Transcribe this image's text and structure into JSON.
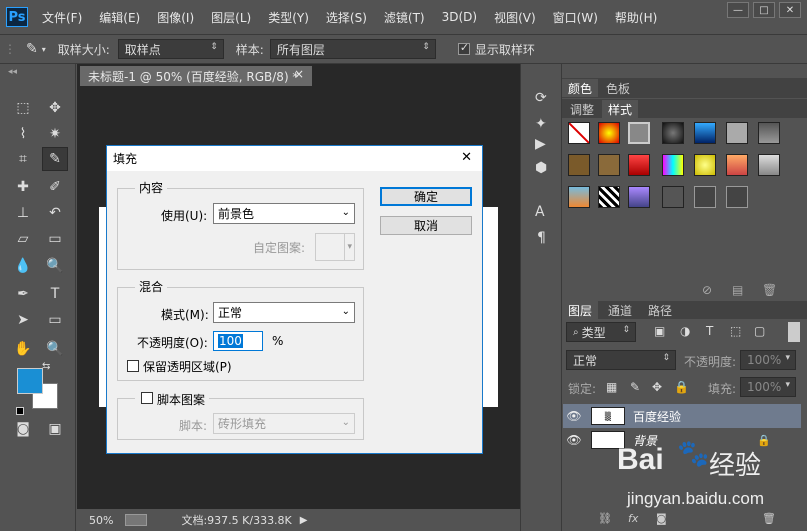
{
  "app": {
    "logo": "Ps"
  },
  "menu": [
    "文件(F)",
    "编辑(E)",
    "图像(I)",
    "图层(L)",
    "类型(Y)",
    "选择(S)",
    "滤镜(T)",
    "3D(D)",
    "视图(V)",
    "窗口(W)",
    "帮助(H)"
  ],
  "window_buttons": {
    "minimize": "—",
    "restore": "□",
    "close": "✕"
  },
  "options": {
    "sample_size_label": "取样大小:",
    "sample_size_value": "取样点",
    "sample_label": "样本:",
    "sample_value": "所有图层",
    "show_ring_label": "显示取样环",
    "show_ring_checked": true
  },
  "document": {
    "tab_title": "未标题-1 @ 50% (百度经验, RGB/8) *",
    "tab_close": "×"
  },
  "status": {
    "zoom": "50%",
    "doc_info": "文档:937.5 K/333.8K"
  },
  "colors": {
    "foreground": "#1a8fd4",
    "background": "#ffffff",
    "accent": "#1979ca"
  },
  "panels": {
    "top_tabs": [
      "颜色",
      "色板"
    ],
    "style_tabs": [
      "调整",
      "样式"
    ],
    "layer_tabs": [
      "图层",
      "通道",
      "路径"
    ],
    "kind_filter": "类型",
    "blend_mode": "正常",
    "opacity_label": "不透明度:",
    "opacity_value": "100%",
    "lock_label": "锁定:",
    "fill_label": "填充:",
    "fill_value": "100%",
    "layers": [
      {
        "name": "百度经验",
        "selected": true,
        "thumb": "text-thumb"
      },
      {
        "name": "背景",
        "selected": false,
        "thumb": "white-thumb",
        "locked": true
      }
    ]
  },
  "dialog": {
    "title": "填充",
    "close": "✕",
    "content_group": "内容",
    "use_label": "使用(U):",
    "use_value": "前景色",
    "custom_pattern_label": "自定图案:",
    "blend_group": "混合",
    "mode_label": "模式(M):",
    "mode_value": "正常",
    "opacity_label": "不透明度(O):",
    "opacity_value": "100",
    "opacity_unit": "%",
    "preserve_transparency": "保留透明区域(P)",
    "script_group": "脚本图案",
    "script_label": "脚本:",
    "script_value": "砖形填充",
    "ok": "确定",
    "cancel": "取消"
  },
  "watermark": {
    "brand": "Bai",
    "brand2": "经验",
    "url": "jingyan.baidu.com"
  }
}
